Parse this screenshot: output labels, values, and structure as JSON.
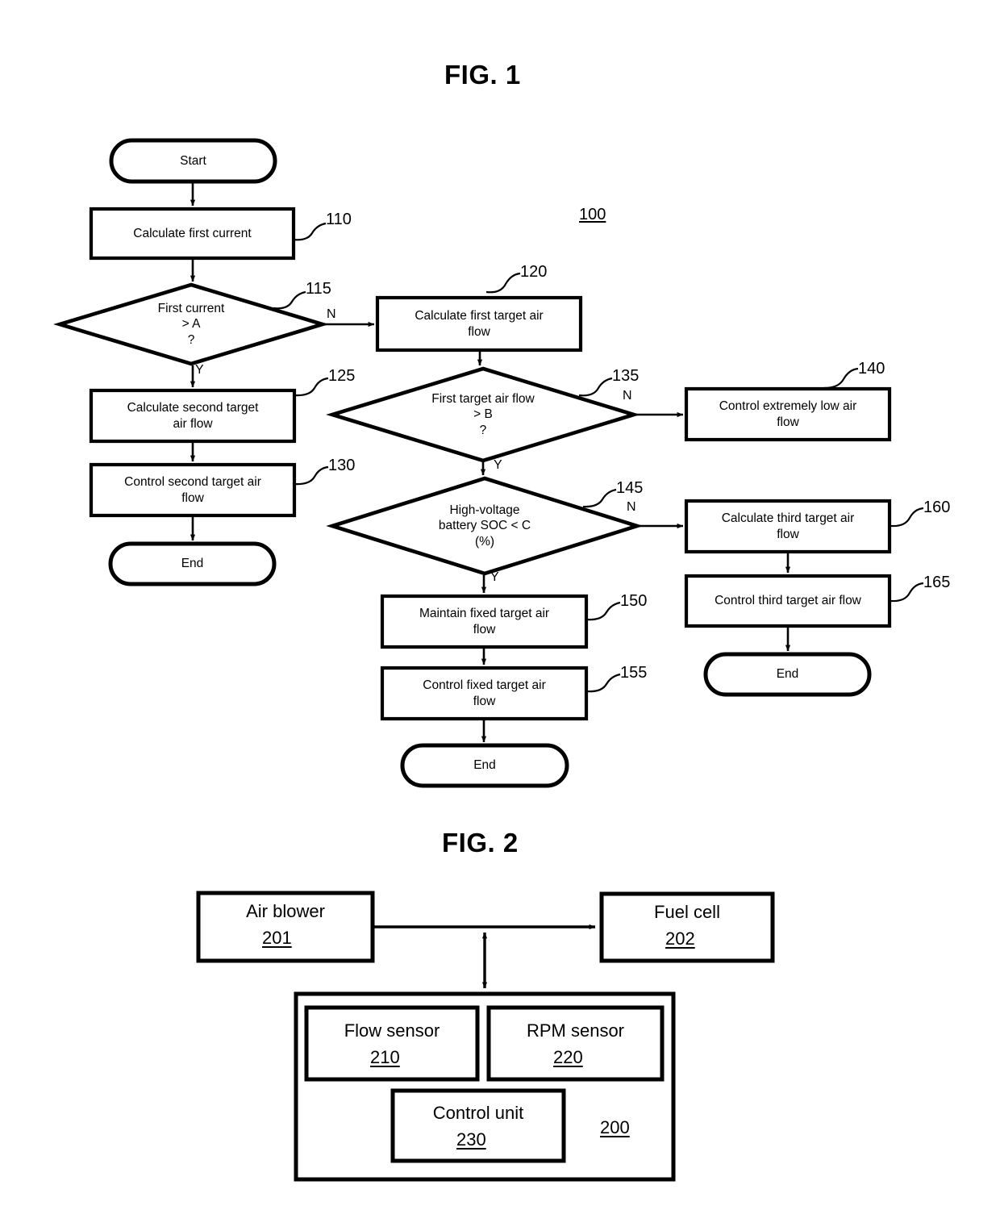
{
  "figures": [
    {
      "title": "FIG. 1",
      "diagram_ref": "100",
      "nodes": {
        "start": "Start",
        "n110": "Calculate first current",
        "n115": "First current\n> A\n?",
        "n120": "Calculate first target air\nflow",
        "n125": "Calculate second target\nair flow",
        "n130": "Control second target air\nflow",
        "n135": "First target air flow\n> B\n?",
        "n140": "Control extremely low air\nflow",
        "n145": "High-voltage\nbattery SOC < C\n(%)",
        "n150": "Maintain fixed target air\nflow",
        "n155": "Control fixed target air\nflow",
        "n160": "Calculate third target air\nflow",
        "n165": "Control third target air flow",
        "end_left": "End",
        "end_mid": "End",
        "end_right": "End"
      },
      "refs": {
        "r110": "110",
        "r115": "115",
        "r120": "120",
        "r125": "125",
        "r130": "130",
        "r135": "135",
        "r140": "140",
        "r145": "145",
        "r150": "150",
        "r155": "155",
        "r160": "160",
        "r165": "165"
      },
      "branches": {
        "b115_n": "N",
        "b115_y": "Y",
        "b135_n": "N",
        "b135_y": "Y",
        "b145_n": "N",
        "b145_y": "Y"
      }
    },
    {
      "title": "FIG. 2",
      "diagram_ref": "200",
      "blocks": {
        "air_blower": {
          "label": "Air blower",
          "num": "201"
        },
        "fuel_cell": {
          "label": "Fuel cell",
          "num": "202"
        },
        "flow_sensor": {
          "label": "Flow sensor",
          "num": "210"
        },
        "rpm_sensor": {
          "label": "RPM sensor",
          "num": "220"
        },
        "control_unit": {
          "label": "Control unit",
          "num": "230"
        }
      }
    }
  ],
  "colors": {
    "ink": "#000000",
    "paper": "#ffffff"
  }
}
